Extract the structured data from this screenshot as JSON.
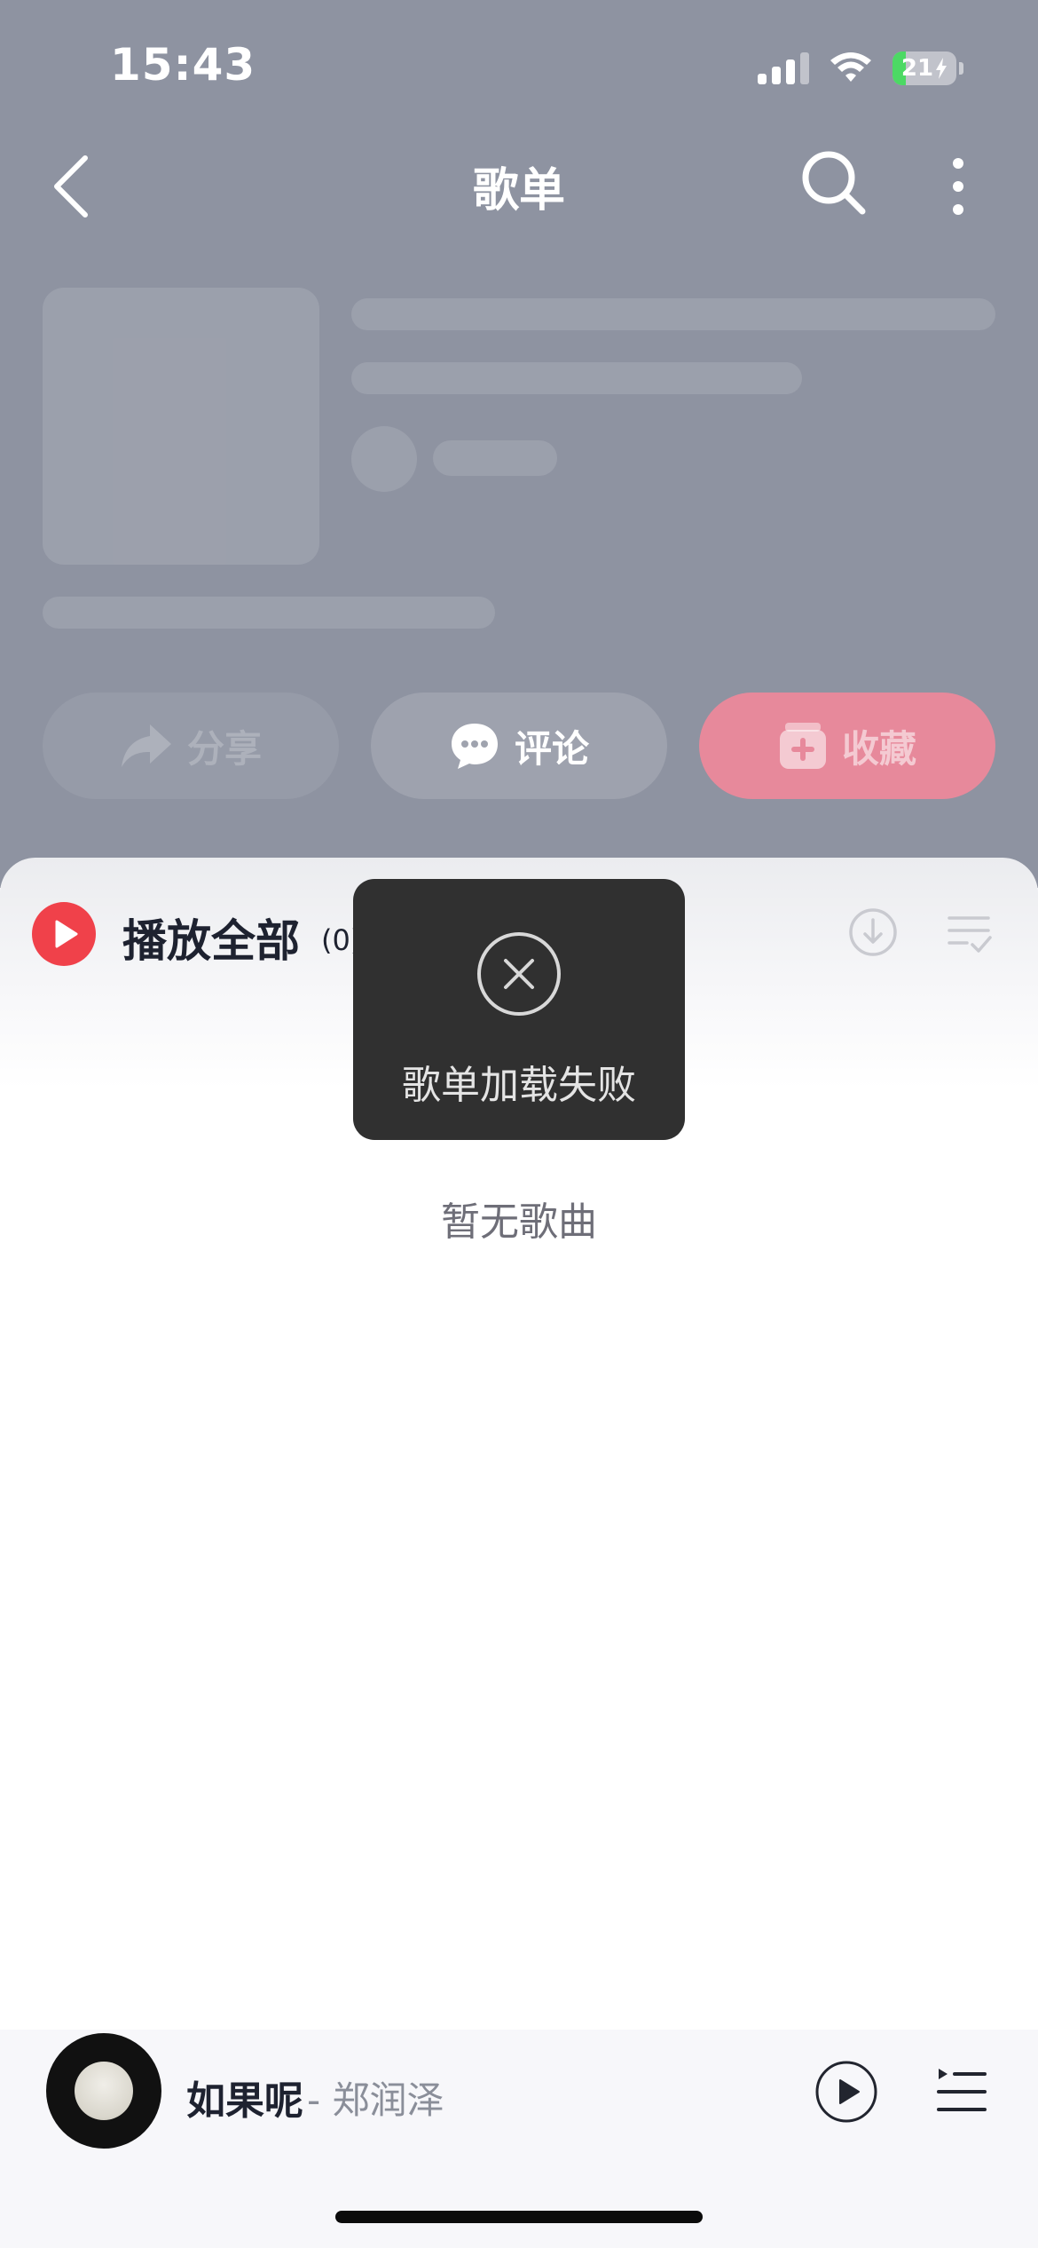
{
  "status_bar": {
    "time": "15:43",
    "battery_level": "21",
    "icons": [
      "signal-icon",
      "wifi-icon",
      "battery-icon",
      "charging-bolt-icon"
    ]
  },
  "nav": {
    "title": "歌单",
    "icons": [
      "back-icon",
      "search-icon",
      "more-icon"
    ]
  },
  "actions": {
    "share_label": "分享",
    "comment_label": "评论",
    "collect_label": "收藏"
  },
  "song_list": {
    "play_all_label": "播放全部",
    "count_label": "(0)",
    "empty_text": "暂无歌曲",
    "icons": [
      "play-all-icon",
      "download-icon",
      "multiselect-icon"
    ]
  },
  "toast": {
    "message": "歌单加载失败",
    "icon": "close-circle-icon"
  },
  "mini_player": {
    "song_title": "如果呢",
    "artist": "- 郑润泽",
    "icons": [
      "play-icon",
      "playlist-icon"
    ]
  },
  "colors": {
    "header_overlay": "#8e93a1",
    "accent_red": "#f0414a",
    "collect_pink": "#e7899b",
    "toast_bg": "#303030",
    "battery_green": "#4cd964"
  }
}
